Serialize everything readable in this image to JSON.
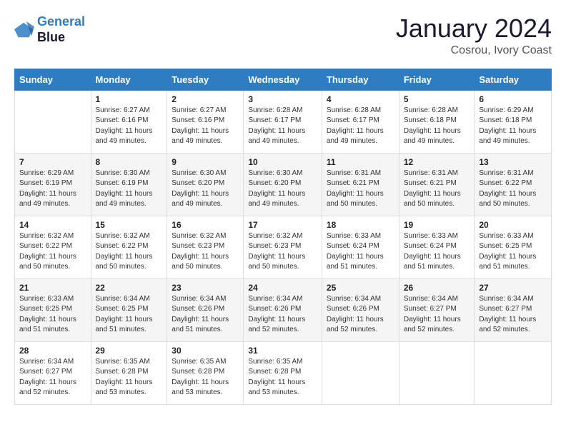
{
  "logo": {
    "line1": "General",
    "line2": "Blue"
  },
  "title": "January 2024",
  "location": "Cosrou, Ivory Coast",
  "weekdays": [
    "Sunday",
    "Monday",
    "Tuesday",
    "Wednesday",
    "Thursday",
    "Friday",
    "Saturday"
  ],
  "weeks": [
    [
      {
        "num": "",
        "empty": true
      },
      {
        "num": "1",
        "sunrise": "6:27 AM",
        "sunset": "6:16 PM",
        "daylight": "11 hours and 49 minutes."
      },
      {
        "num": "2",
        "sunrise": "6:27 AM",
        "sunset": "6:16 PM",
        "daylight": "11 hours and 49 minutes."
      },
      {
        "num": "3",
        "sunrise": "6:28 AM",
        "sunset": "6:17 PM",
        "daylight": "11 hours and 49 minutes."
      },
      {
        "num": "4",
        "sunrise": "6:28 AM",
        "sunset": "6:17 PM",
        "daylight": "11 hours and 49 minutes."
      },
      {
        "num": "5",
        "sunrise": "6:28 AM",
        "sunset": "6:18 PM",
        "daylight": "11 hours and 49 minutes."
      },
      {
        "num": "6",
        "sunrise": "6:29 AM",
        "sunset": "6:18 PM",
        "daylight": "11 hours and 49 minutes."
      }
    ],
    [
      {
        "num": "7",
        "sunrise": "6:29 AM",
        "sunset": "6:19 PM",
        "daylight": "11 hours and 49 minutes."
      },
      {
        "num": "8",
        "sunrise": "6:30 AM",
        "sunset": "6:19 PM",
        "daylight": "11 hours and 49 minutes."
      },
      {
        "num": "9",
        "sunrise": "6:30 AM",
        "sunset": "6:20 PM",
        "daylight": "11 hours and 49 minutes."
      },
      {
        "num": "10",
        "sunrise": "6:30 AM",
        "sunset": "6:20 PM",
        "daylight": "11 hours and 49 minutes."
      },
      {
        "num": "11",
        "sunrise": "6:31 AM",
        "sunset": "6:21 PM",
        "daylight": "11 hours and 50 minutes."
      },
      {
        "num": "12",
        "sunrise": "6:31 AM",
        "sunset": "6:21 PM",
        "daylight": "11 hours and 50 minutes."
      },
      {
        "num": "13",
        "sunrise": "6:31 AM",
        "sunset": "6:22 PM",
        "daylight": "11 hours and 50 minutes."
      }
    ],
    [
      {
        "num": "14",
        "sunrise": "6:32 AM",
        "sunset": "6:22 PM",
        "daylight": "11 hours and 50 minutes."
      },
      {
        "num": "15",
        "sunrise": "6:32 AM",
        "sunset": "6:22 PM",
        "daylight": "11 hours and 50 minutes."
      },
      {
        "num": "16",
        "sunrise": "6:32 AM",
        "sunset": "6:23 PM",
        "daylight": "11 hours and 50 minutes."
      },
      {
        "num": "17",
        "sunrise": "6:32 AM",
        "sunset": "6:23 PM",
        "daylight": "11 hours and 50 minutes."
      },
      {
        "num": "18",
        "sunrise": "6:33 AM",
        "sunset": "6:24 PM",
        "daylight": "11 hours and 51 minutes."
      },
      {
        "num": "19",
        "sunrise": "6:33 AM",
        "sunset": "6:24 PM",
        "daylight": "11 hours and 51 minutes."
      },
      {
        "num": "20",
        "sunrise": "6:33 AM",
        "sunset": "6:25 PM",
        "daylight": "11 hours and 51 minutes."
      }
    ],
    [
      {
        "num": "21",
        "sunrise": "6:33 AM",
        "sunset": "6:25 PM",
        "daylight": "11 hours and 51 minutes."
      },
      {
        "num": "22",
        "sunrise": "6:34 AM",
        "sunset": "6:25 PM",
        "daylight": "11 hours and 51 minutes."
      },
      {
        "num": "23",
        "sunrise": "6:34 AM",
        "sunset": "6:26 PM",
        "daylight": "11 hours and 51 minutes."
      },
      {
        "num": "24",
        "sunrise": "6:34 AM",
        "sunset": "6:26 PM",
        "daylight": "11 hours and 52 minutes."
      },
      {
        "num": "25",
        "sunrise": "6:34 AM",
        "sunset": "6:26 PM",
        "daylight": "11 hours and 52 minutes."
      },
      {
        "num": "26",
        "sunrise": "6:34 AM",
        "sunset": "6:27 PM",
        "daylight": "11 hours and 52 minutes."
      },
      {
        "num": "27",
        "sunrise": "6:34 AM",
        "sunset": "6:27 PM",
        "daylight": "11 hours and 52 minutes."
      }
    ],
    [
      {
        "num": "28",
        "sunrise": "6:34 AM",
        "sunset": "6:27 PM",
        "daylight": "11 hours and 52 minutes."
      },
      {
        "num": "29",
        "sunrise": "6:35 AM",
        "sunset": "6:28 PM",
        "daylight": "11 hours and 53 minutes."
      },
      {
        "num": "30",
        "sunrise": "6:35 AM",
        "sunset": "6:28 PM",
        "daylight": "11 hours and 53 minutes."
      },
      {
        "num": "31",
        "sunrise": "6:35 AM",
        "sunset": "6:28 PM",
        "daylight": "11 hours and 53 minutes."
      },
      {
        "num": "",
        "empty": true
      },
      {
        "num": "",
        "empty": true
      },
      {
        "num": "",
        "empty": true
      }
    ]
  ]
}
